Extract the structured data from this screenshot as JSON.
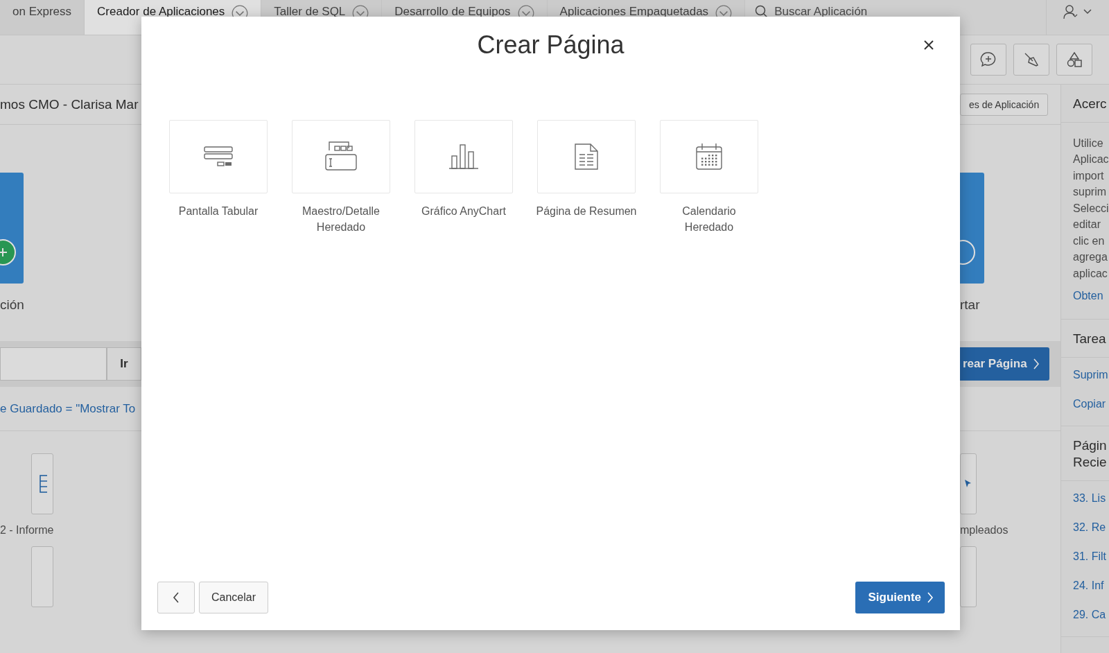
{
  "top_tabs": [
    {
      "label": "on Express",
      "selected": false,
      "has_menu": false
    },
    {
      "label": "Creador de Aplicaciones",
      "selected": true,
      "has_menu": true
    },
    {
      "label": "Taller de SQL",
      "selected": false,
      "has_menu": true
    },
    {
      "label": "Desarrollo de Equipos",
      "selected": false,
      "has_menu": true
    },
    {
      "label": "Aplicaciones Empaquetadas",
      "selected": false,
      "has_menu": true
    }
  ],
  "search": {
    "placeholder": "Buscar Aplicación"
  },
  "page": {
    "title": "mos CMO - Clarisa Mar",
    "header_button": "es de Aplicación",
    "hero_left": "ción",
    "hero_right": "rtar",
    "go_button": "Ir",
    "create_button": "rear Página",
    "filter_link": "e Guardado = \"Mostrar To",
    "card_left": "2 - Informe",
    "card_right": "mpleados"
  },
  "sidebar": {
    "about_title": "Acerc",
    "about_lines": [
      "Utilice",
      "Aplicac",
      "import",
      "suprim",
      "Selecci",
      "editar",
      "clic en",
      "agrega",
      "aplicac"
    ],
    "about_link": "Obten",
    "tasks_title": "Tarea",
    "tasks": [
      "Suprim",
      "Copiar"
    ],
    "recent_title": "Págin\nRecie",
    "recent": [
      "33. Lis",
      "32. Re",
      "31. Filt",
      "24. Inf",
      "29. Ca"
    ]
  },
  "dialog": {
    "title": "Crear Página",
    "options": [
      {
        "label": "Pantalla Tabular",
        "kind": "tabular"
      },
      {
        "label": "Maestro/Detalle\nHeredado",
        "kind": "master"
      },
      {
        "label": "Gráfico AnyChart",
        "kind": "chart"
      },
      {
        "label": "Página de Resumen",
        "kind": "summary"
      },
      {
        "label": "Calendario\nHeredado",
        "kind": "calendar"
      }
    ],
    "cancel": "Cancelar",
    "next": "Siguiente"
  }
}
